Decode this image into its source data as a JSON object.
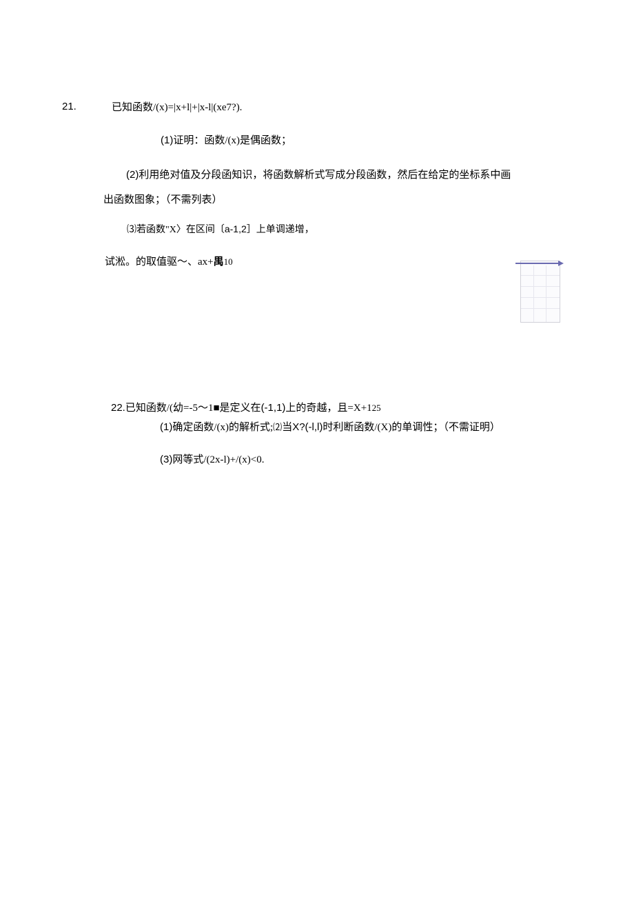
{
  "q21": {
    "num": "21.",
    "l1": "已知函数/(x)=|x+l|+|x-l|(xe7?).",
    "l2_a": "(1)",
    "l2_b": "证明：函数/(x)是偶函数；",
    "l3_a": "(2)",
    "l3_b": "利用绝对值及分段函知识，将函数解析式写成分段函数，然后在给定的坐标系中画",
    "l4": "出函数图象；（不需列表）",
    "l5_a": "⑶若函数\"X〉在区间〔",
    "l5_b": "a-1,2",
    "l5_c": "］上单调递增，",
    "l6_a": "试淞。的取值驱〜、ax+",
    "l6_b": "禺",
    "l6_c": "10"
  },
  "q22": {
    "num": "22.",
    "l1_a": "已知函数/(幼=-5～1",
    "l1_b": "■",
    "l1_c": "是定义在",
    "l1_d": "(-1,1)",
    "l1_e": "上的奇越，且=X+1",
    "l1_f": "25",
    "l2_a": "(1)",
    "l2_b": "确定函数/(x)的解析式;",
    "l2_c": "⑵",
    "l2_d": "当",
    "l2_e": "X?(-l,l)",
    "l2_f": "时利断函数/(X)的单调性；（不需证明）",
    "l3_a": "(3)",
    "l3_b": "网等式/(2x-l)+/(x)<0."
  }
}
